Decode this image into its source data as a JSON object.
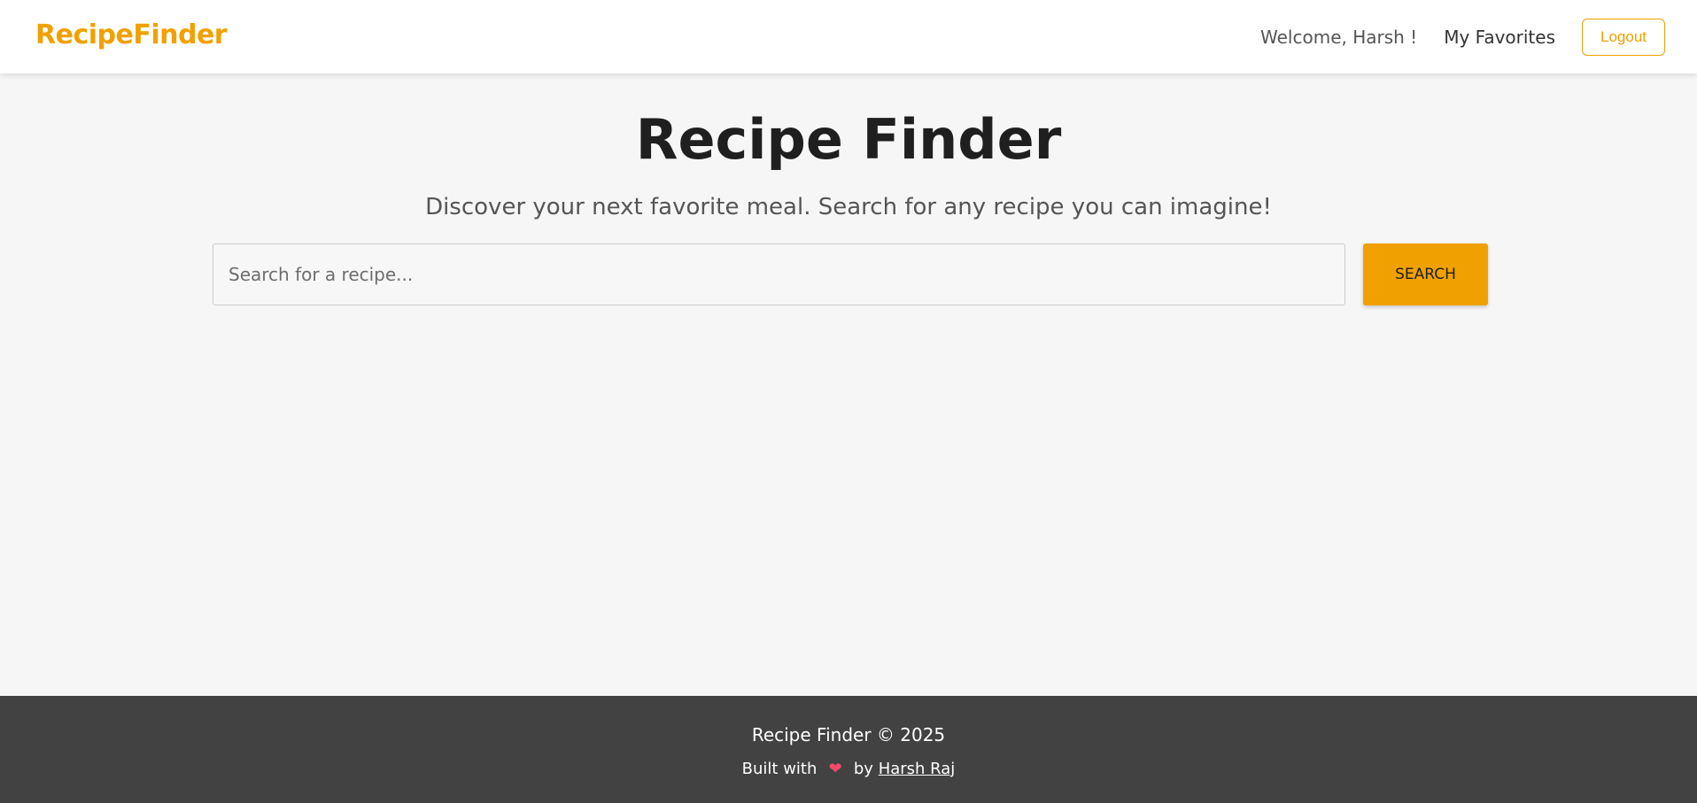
{
  "nav": {
    "brand": "RecipeFinder",
    "welcome": "Welcome, Harsh !",
    "favorites": "My Favorites",
    "logout": "Logout"
  },
  "hero": {
    "title": "Recipe Finder",
    "subtitle": "Discover your next favorite meal. Search for any recipe you can imagine!"
  },
  "search": {
    "placeholder": "Search for a recipe...",
    "value": "",
    "button": "SEARCH"
  },
  "footer": {
    "copyright": "Recipe Finder © 2025",
    "built_prefix": "Built with",
    "heart_icon": "heart-icon",
    "built_by": "by",
    "author": "Harsh Raj"
  },
  "colors": {
    "accent": "#f0a100",
    "background": "#f6f6f6",
    "navbar": "#ffffff",
    "footer": "#424242",
    "heading": "#1f1f1f",
    "heart": "#ef4a6e"
  }
}
